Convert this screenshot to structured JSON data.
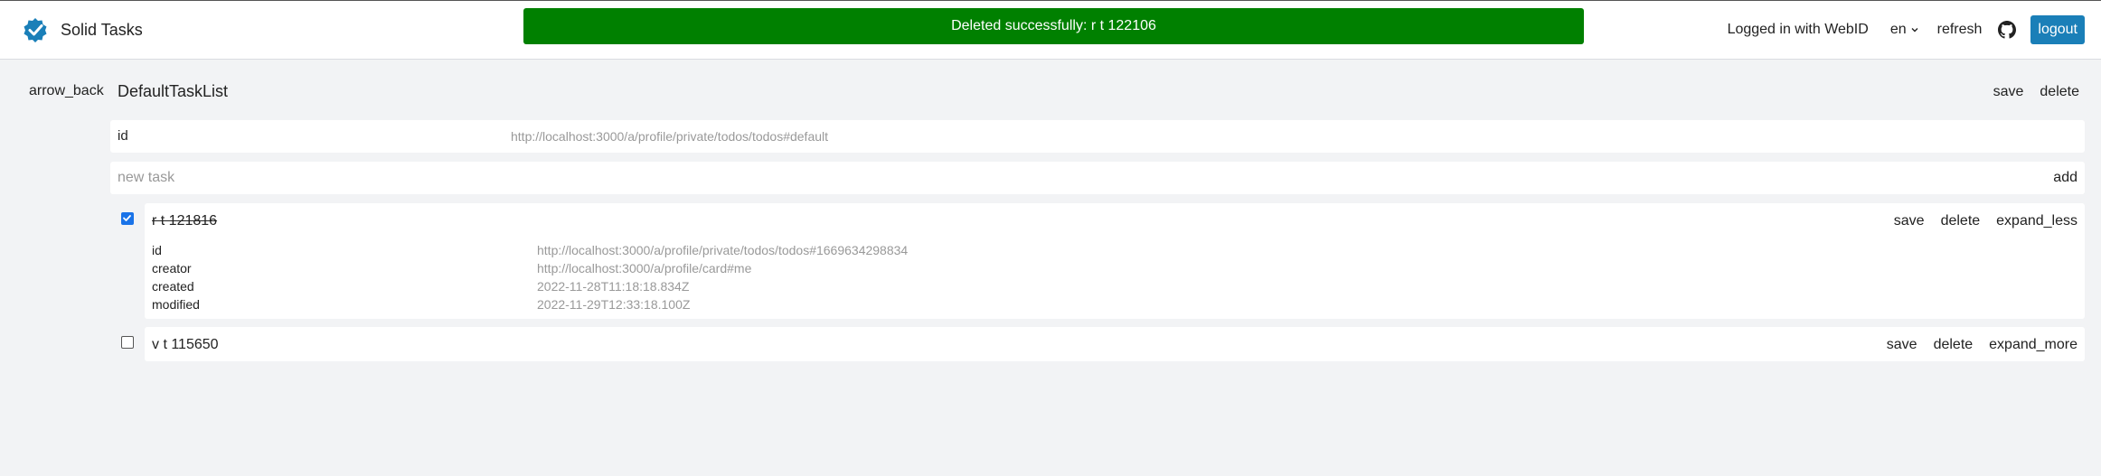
{
  "header": {
    "title": "Solid Tasks",
    "toast": "Deleted successfully: r t 122106",
    "logged_in": "Logged in with WebID",
    "lang": "en",
    "refresh": "refresh",
    "logout": "logout"
  },
  "list": {
    "back": "arrow_back",
    "title": "DefaultTaskList",
    "save": "save",
    "delete": "delete",
    "id_label": "id",
    "id_value": "http://localhost:3000/a/profile/private/todos/todos#default"
  },
  "new_task": {
    "placeholder": "new task",
    "value": "",
    "add": "add"
  },
  "tasks": [
    {
      "title": "r t 121816",
      "checked": true,
      "save": "save",
      "delete": "delete",
      "toggle": "expand_less",
      "details": [
        {
          "k": "id",
          "v": "http://localhost:3000/a/profile/private/todos/todos#1669634298834"
        },
        {
          "k": "creator",
          "v": "http://localhost:3000/a/profile/card#me"
        },
        {
          "k": "created",
          "v": "2022-11-28T11:18:18.834Z"
        },
        {
          "k": "modified",
          "v": "2022-11-29T12:33:18.100Z"
        }
      ]
    },
    {
      "title": "v t 115650",
      "checked": false,
      "save": "save",
      "delete": "delete",
      "toggle": "expand_more"
    }
  ],
  "colors": {
    "toast_bg": "#008000",
    "logout_bg": "#1a7fb8",
    "checkbox_checked": "#1a73e8",
    "logo": "#1a7fb8"
  },
  "icons": {
    "logo": "check-badge-icon",
    "lang_chevron": "chevron-down-icon",
    "github": "github-icon",
    "checkbox_check": "check-icon"
  }
}
